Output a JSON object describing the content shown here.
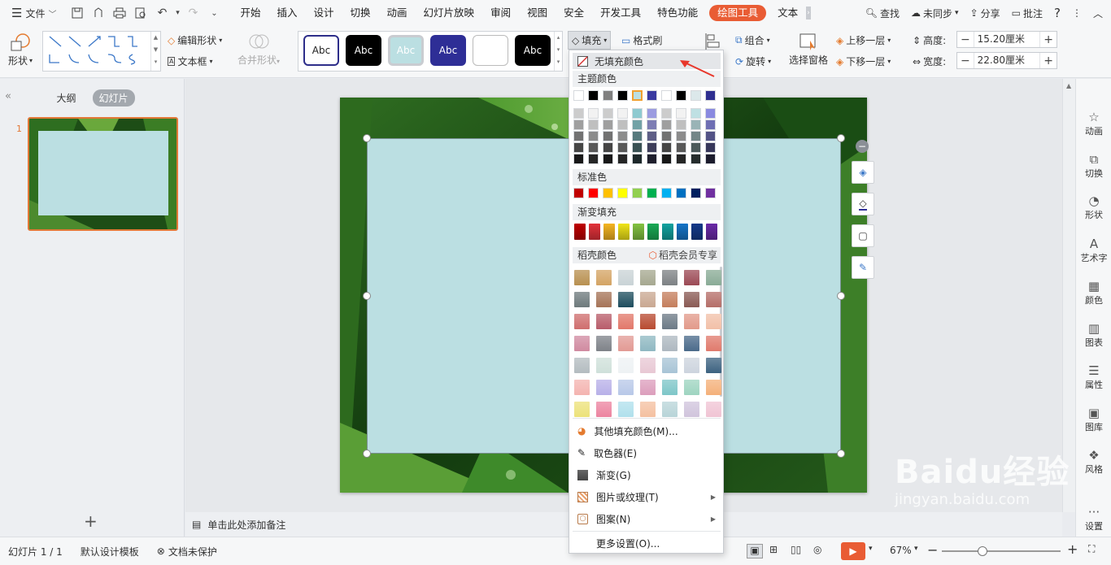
{
  "menubar": {
    "file_label": "文件",
    "tabs": [
      "开始",
      "插入",
      "设计",
      "切换",
      "动画",
      "幻灯片放映",
      "审阅",
      "视图",
      "安全",
      "开发工具",
      "特色功能",
      "绘图工具",
      "文本"
    ],
    "active_tab": "绘图工具",
    "search": "查找",
    "sync": "未同步",
    "share": "分享",
    "comment": "批注"
  },
  "ribbon": {
    "shape_label": "形状",
    "edit_shape": "编辑形状",
    "textbox": "文本框",
    "merge_shape": "合并形状",
    "style_sample": "Abc",
    "fill": "填充",
    "format_brush": "格式刷",
    "group": "组合",
    "rotate": "旋转",
    "selection_pane": "选择窗格",
    "bring_forward": "上移一层",
    "send_backward": "下移一层",
    "height_label": "高度:",
    "height_value": "15.20厘米",
    "width_label": "宽度:",
    "width_value": "22.80厘米"
  },
  "leftpanel": {
    "outline_tab": "大纲",
    "slides_tab": "幻灯片",
    "slide_number": "1"
  },
  "notes_placeholder": "单击此处添加备注",
  "rightside": [
    "动画",
    "切换",
    "形状",
    "艺术字",
    "颜色",
    "图表",
    "属性",
    "图库",
    "风格",
    "设置"
  ],
  "status": {
    "slide_info": "幻灯片 1 / 1",
    "template": "默认设计模板",
    "protect": "文档未保护",
    "zoom": "67%"
  },
  "dropdown": {
    "no_fill": "无填充颜色",
    "theme_colors": "主题颜色",
    "standard_colors": "标准色",
    "gradient_fill": "渐变填充",
    "daoke_colors": "稻壳颜色",
    "member_only": "稻壳会员专享",
    "more_fill": "其他填充颜色(M)...",
    "eyedropper": "取色器(E)",
    "gradient": "渐变(G)",
    "picture_texture": "图片或纹理(T)",
    "pattern": "图案(N)",
    "more_settings": "更多设置(O)...",
    "theme_row": [
      "#ffffff",
      "#000000",
      "#808080",
      "#000000",
      "#bbdfe2",
      "#3a3aa0",
      "#ffffff",
      "#000000",
      "#dce8ea",
      "#2f2f90"
    ],
    "standard_row": [
      "#c00000",
      "#ff0000",
      "#ffc000",
      "#ffff00",
      "#92d050",
      "#00b050",
      "#00b0f0",
      "#0070c0",
      "#002060",
      "#7030a0"
    ],
    "gradient_row": [
      "#c00000",
      "#e3323a",
      "#f5b521",
      "#f0e518",
      "#84c341",
      "#1aaa55",
      "#12a3a0",
      "#1675c7",
      "#143a8a",
      "#6b2aa8"
    ]
  },
  "watermark": {
    "brand": "Baidu经验",
    "url": "jingyan.baidu.com"
  }
}
